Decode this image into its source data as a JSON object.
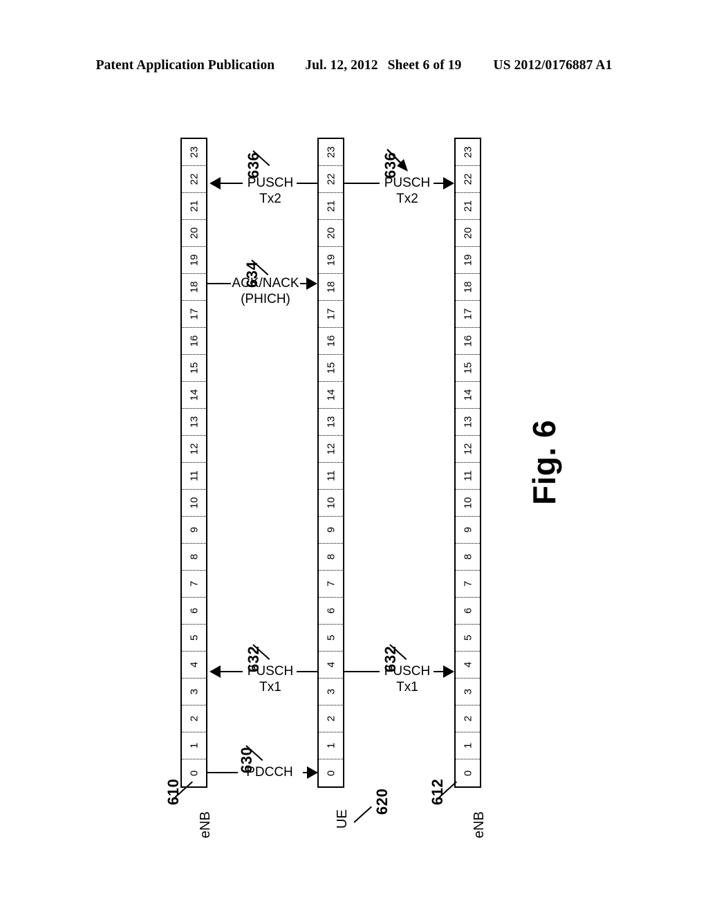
{
  "header": {
    "publication": "Patent Application Publication",
    "date": "Jul. 12, 2012",
    "sheet": "Sheet 6 of 19",
    "docnumber": "US 2012/0176887 A1"
  },
  "figure": {
    "caption": "Fig. 6",
    "subframe_numbers": [
      "23",
      "22",
      "21",
      "20",
      "19",
      "18",
      "17",
      "16",
      "15",
      "14",
      "13",
      "12",
      "11",
      "10",
      "9",
      "8",
      "7",
      "6",
      "5",
      "4",
      "3",
      "2",
      "1",
      "0"
    ],
    "columns": [
      {
        "id": "enb1",
        "node_label": "eNB",
        "ref": "610"
      },
      {
        "id": "ue",
        "node_label": "UE",
        "ref": "620"
      },
      {
        "id": "enb2",
        "node_label": "eNB",
        "ref": "612"
      }
    ],
    "messages": [
      {
        "id": "pdcch",
        "ref": "630",
        "line1": "PDCCH",
        "line2": "",
        "direction": "right",
        "from": "enb1",
        "to": "ue",
        "subframe": "0"
      },
      {
        "id": "pusch-tx1-left",
        "ref": "632",
        "line1": "PUSCH",
        "line2": "Tx1",
        "direction": "left",
        "from": "ue",
        "to": "enb1",
        "subframe": "4"
      },
      {
        "id": "pusch-tx1-right",
        "ref": "632",
        "line1": "PUSCH",
        "line2": "Tx1",
        "direction": "right",
        "from": "ue",
        "to": "enb2",
        "subframe": "4"
      },
      {
        "id": "ack-nack",
        "ref": "634",
        "line1": "ACK/NACK",
        "line2": "(PHICH)",
        "direction": "right",
        "from": "enb1",
        "to": "ue",
        "subframe": "18"
      },
      {
        "id": "pusch-tx2-left",
        "ref": "636",
        "line1": "PUSCH",
        "line2": "Tx2",
        "direction": "left",
        "from": "ue",
        "to": "enb1",
        "subframe": "22"
      },
      {
        "id": "pusch-tx2-right",
        "ref": "636",
        "line1": "PUSCH",
        "line2": "Tx2",
        "direction": "right",
        "from": "ue",
        "to": "enb2",
        "subframe": "22"
      }
    ]
  },
  "colors": {
    "ink": "#000000",
    "paper": "#ffffff"
  }
}
